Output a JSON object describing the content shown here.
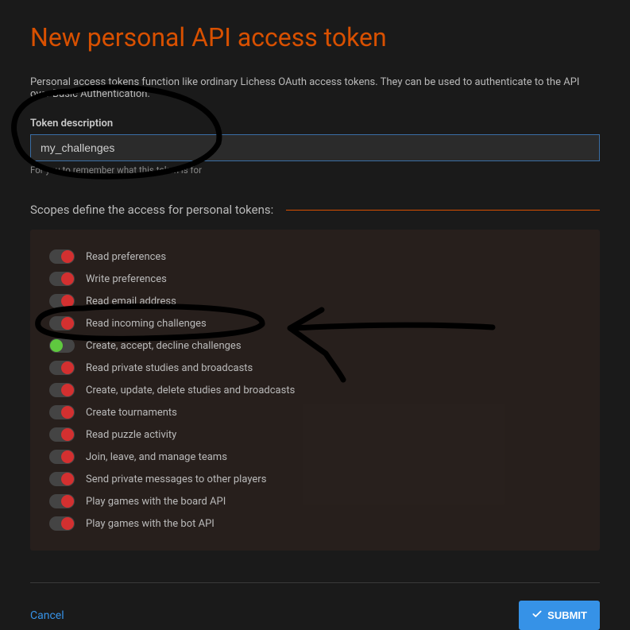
{
  "title": "New personal API access token",
  "description": "Personal access tokens function like ordinary Lichess OAuth access tokens. They can be used to authenticate to the API over Basic Authentication.",
  "token_field": {
    "label": "Token description",
    "value": "my_challenges",
    "hint": "For you to remember what this token is for"
  },
  "scopes_header": "Scopes define the access for personal tokens:",
  "scopes": [
    {
      "label": "Read preferences",
      "enabled": false
    },
    {
      "label": "Write preferences",
      "enabled": false
    },
    {
      "label": "Read email address",
      "enabled": false
    },
    {
      "label": "Read incoming challenges",
      "enabled": false
    },
    {
      "label": "Create, accept, decline challenges",
      "enabled": true
    },
    {
      "label": "Read private studies and broadcasts",
      "enabled": false
    },
    {
      "label": "Create, update, delete studies and broadcasts",
      "enabled": false
    },
    {
      "label": "Create tournaments",
      "enabled": false
    },
    {
      "label": "Read puzzle activity",
      "enabled": false
    },
    {
      "label": "Join, leave, and manage teams",
      "enabled": false
    },
    {
      "label": "Send private messages to other players",
      "enabled": false
    },
    {
      "label": "Play games with the board API",
      "enabled": false
    },
    {
      "label": "Play games with the bot API",
      "enabled": false
    }
  ],
  "footer": {
    "cancel": "Cancel",
    "submit": "SUBMIT"
  }
}
